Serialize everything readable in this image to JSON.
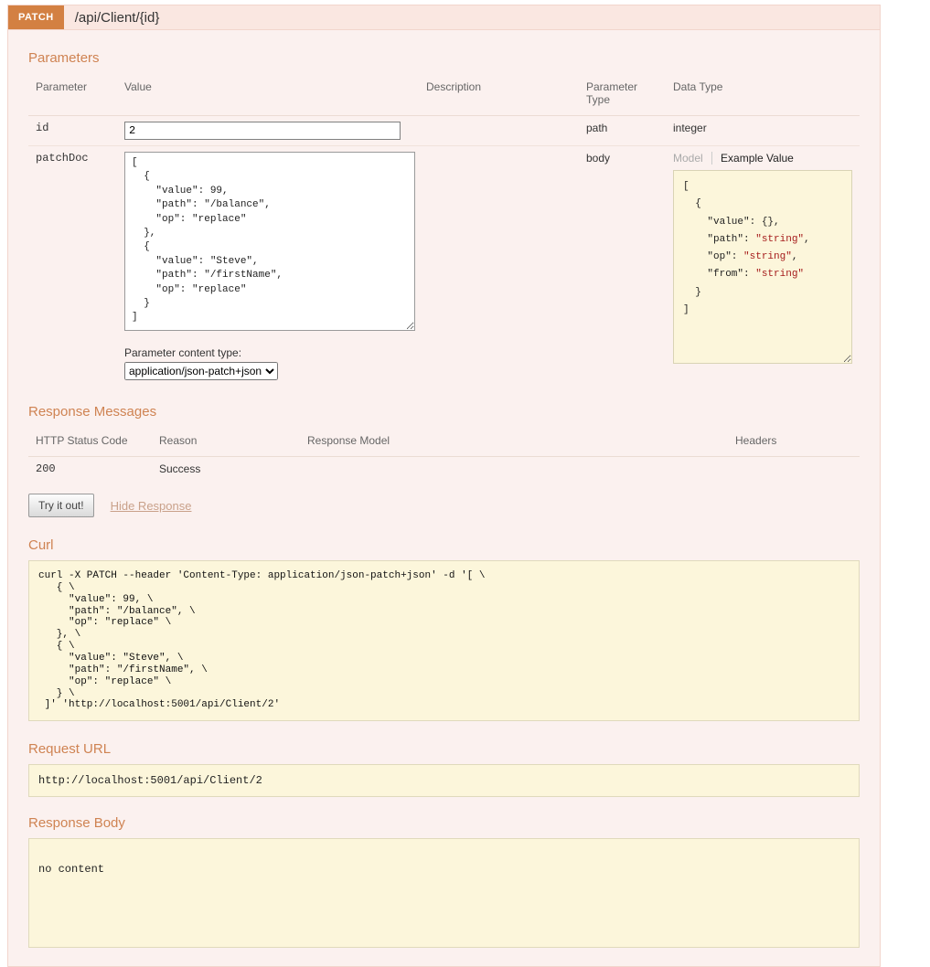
{
  "header": {
    "method": "PATCH",
    "path": "/api/Client/{id}"
  },
  "parameters": {
    "heading": "Parameters",
    "columns": [
      "Parameter",
      "Value",
      "Description",
      "Parameter Type",
      "Data Type"
    ],
    "rows": [
      {
        "name": "id",
        "value": "2",
        "description": "",
        "param_type": "path",
        "data_type": "integer"
      },
      {
        "name": "patchDoc",
        "value": "[\n  {\n    \"value\": 99,\n    \"path\": \"/balance\",\n    \"op\": \"replace\"\n  },\n  {\n    \"value\": \"Steve\",\n    \"path\": \"/firstName\",\n    \"op\": \"replace\"\n  }\n]",
        "description": "",
        "param_type": "body",
        "tabs": {
          "model": "Model",
          "example": "Example Value"
        },
        "example_value": "[\n  {\n    \"value\": {},\n    \"path\": \"string\",\n    \"op\": \"string\",\n    \"from\": \"string\"\n  }\n]"
      }
    ],
    "content_type_label": "Parameter content type:",
    "content_type_value": "application/json-patch+json"
  },
  "response_messages": {
    "heading": "Response Messages",
    "columns": [
      "HTTP Status Code",
      "Reason",
      "Response Model",
      "Headers"
    ],
    "rows": [
      {
        "code": "200",
        "reason": "Success",
        "model": "",
        "headers": ""
      }
    ]
  },
  "actions": {
    "try_it_out": "Try it out!",
    "hide_response": "Hide Response"
  },
  "curl": {
    "heading": "Curl",
    "command": "curl -X PATCH --header 'Content-Type: application/json-patch+json' -d '[ \\\n   { \\\n     \"value\": 99, \\\n     \"path\": \"/balance\", \\\n     \"op\": \"replace\" \\\n   }, \\\n   { \\\n     \"value\": \"Steve\", \\\n     \"path\": \"/firstName\", \\\n     \"op\": \"replace\" \\\n   } \\\n ]' 'http://localhost:5001/api/Client/2'"
  },
  "request_url": {
    "heading": "Request URL",
    "url": "http://localhost:5001/api/Client/2"
  },
  "response_body": {
    "heading": "Response Body",
    "content": "no content"
  },
  "colors": {
    "method_badge": "#D38042",
    "section_heading": "#CF8352",
    "example_string": "#A51B1B",
    "panel_bg": "#FBF1EF",
    "code_bg": "#FCF6DB"
  }
}
